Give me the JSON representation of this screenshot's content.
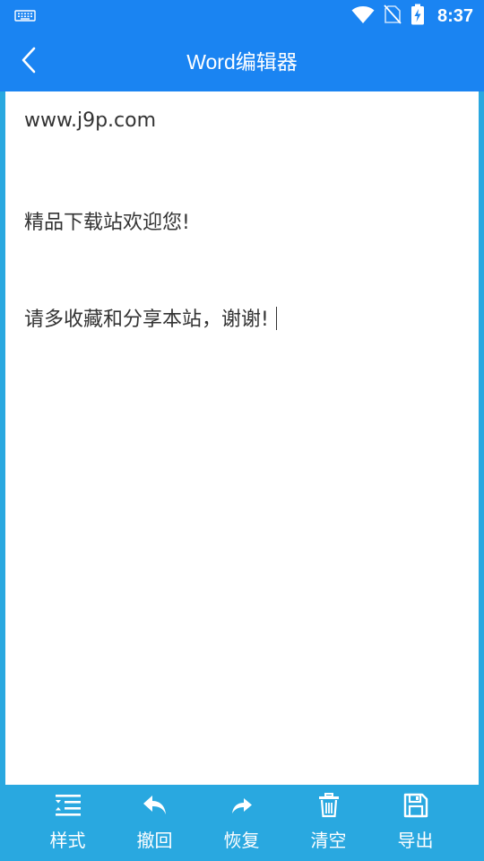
{
  "status_bar": {
    "time": "8:37",
    "icons": [
      "keyboard-icon",
      "wifi-icon",
      "no-sim-icon",
      "battery-charging-icon"
    ]
  },
  "app_bar": {
    "title": "Word编辑器",
    "back_icon": "back-arrow-icon"
  },
  "editor": {
    "lines": [
      "www.j9p.com",
      "精品下载站欢迎您!",
      "请多收藏和分享本站，谢谢!"
    ]
  },
  "toolbar": {
    "items": [
      {
        "label": "样式",
        "icon": "format-lines-icon"
      },
      {
        "label": "撤回",
        "icon": "undo-icon"
      },
      {
        "label": "恢复",
        "icon": "redo-icon"
      },
      {
        "label": "清空",
        "icon": "trash-icon"
      },
      {
        "label": "导出",
        "icon": "save-icon"
      }
    ]
  },
  "colors": {
    "primary": "#1A84F2",
    "toolbar": "#29A8E0",
    "editor_bg": "#FFFFFF",
    "text": "#333333"
  }
}
